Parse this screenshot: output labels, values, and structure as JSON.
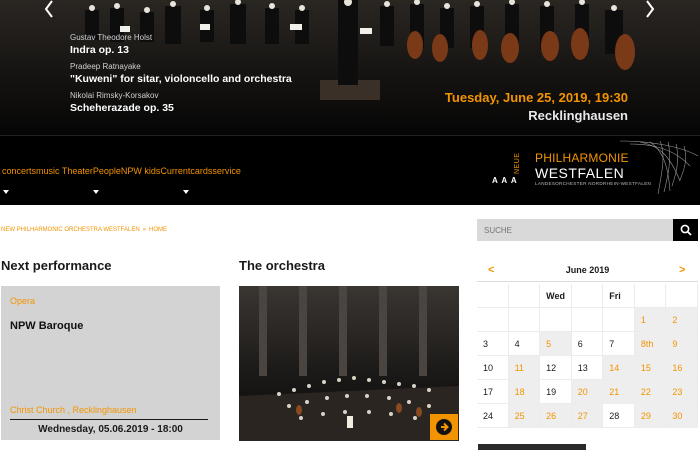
{
  "hero": {
    "program": [
      {
        "composer": "Gustav Theodore Holst",
        "work": "Indra op. 13"
      },
      {
        "composer": "Pradeep Ratnayake",
        "work": "\"Kuweni\" for sitar, violoncello and orchestra"
      },
      {
        "composer": "Nikolai Rimsky-Korsakov",
        "work": "Scheherazade op. 35"
      }
    ],
    "date": "Tuesday, June 25, 2019, 19:30",
    "city": "Recklinghausen"
  },
  "nav": {
    "text": "concertsmusic TheaterPeopleNPW kidsCurrentcardsservice"
  },
  "logo": {
    "aaa": "A A A",
    "neue": "NEUE",
    "philharmonie": "PHILHARMONIE",
    "westfalen": "WESTFALEN",
    "subline": "LANDESORCHESTER NORDRHEIN-WESTFALEN"
  },
  "breadcrumb": {
    "items": [
      "NEW PHILHARMONIC ORCHESTRA WESTFALEN",
      "HOME"
    ],
    "separator": "»"
  },
  "search": {
    "placeholder": "SUCHE",
    "icon": "search-icon"
  },
  "next_performance": {
    "heading": "Next performance",
    "category": "Opera",
    "title": "NPW Baroque",
    "venue": "Christ Church , Recklinghausen",
    "date": "Wednesday, 05.06.2019 - 18:00"
  },
  "orchestra": {
    "heading": "The orchestra",
    "button_icon": "arrow-right-circle-icon"
  },
  "calendar": {
    "month": "June 2019",
    "prev": "<",
    "next": ">",
    "weekdays": [
      "",
      "",
      "Wed",
      "",
      "Fri",
      "",
      ""
    ],
    "rows": [
      [
        "",
        "",
        "",
        "",
        "",
        "1",
        "2"
      ],
      [
        "3",
        "4",
        "5",
        "6",
        "7",
        "8th",
        "9"
      ],
      [
        "10",
        "11",
        "12",
        "13",
        "14",
        "15",
        "16"
      ],
      [
        "17",
        "18",
        "19",
        "20",
        "21",
        "22",
        "23"
      ],
      [
        "24",
        "25",
        "26",
        "27",
        "28",
        "29",
        "30"
      ]
    ],
    "event_days": [
      "1",
      "2",
      "5",
      "8th",
      "9",
      "11",
      "14",
      "15",
      "16",
      "18",
      "20",
      "21",
      "22",
      "23",
      "25",
      "26",
      "27",
      "29",
      "30"
    ]
  },
  "colors": {
    "accent": "#f29400",
    "nav_bg": "#000000",
    "card_bg": "#d3d3d3"
  }
}
